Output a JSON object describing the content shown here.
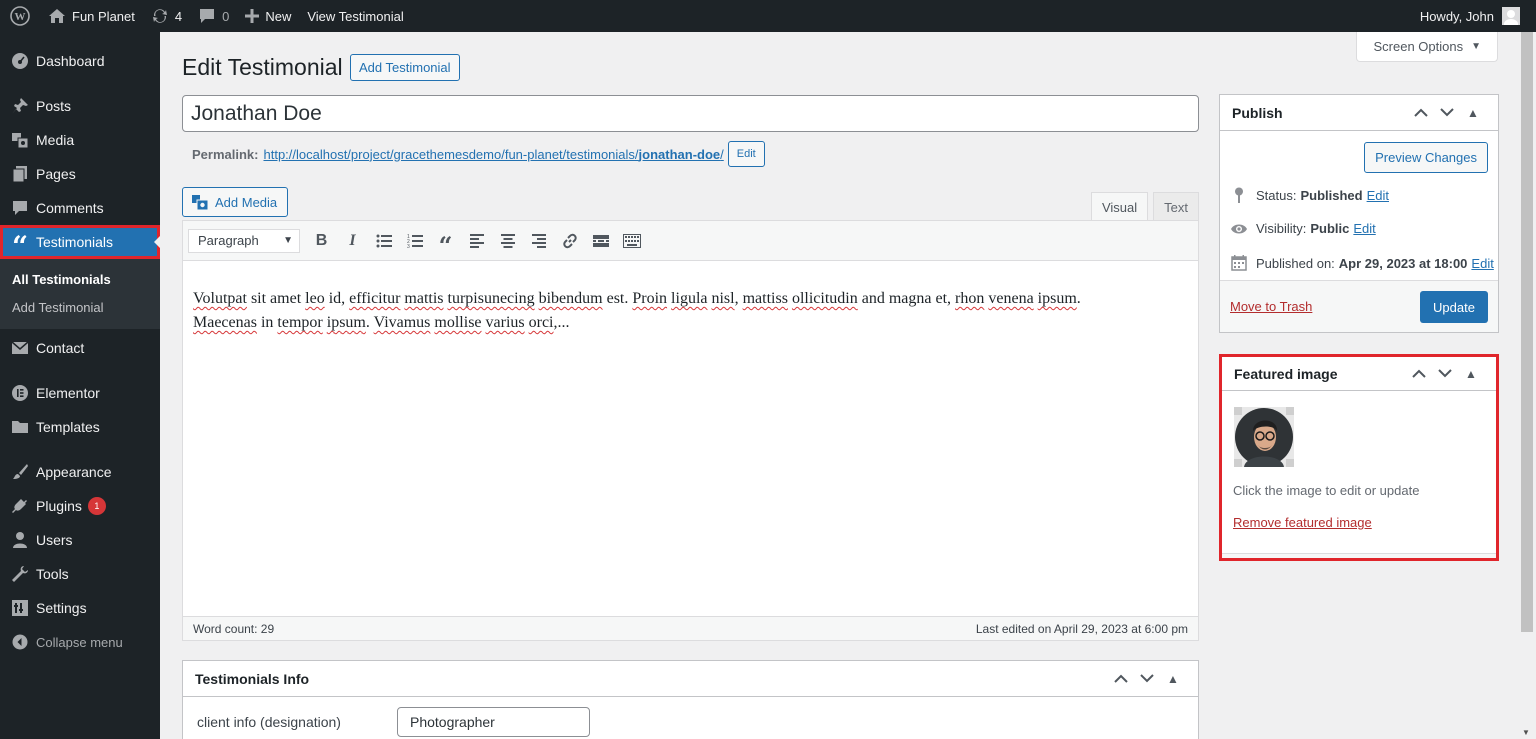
{
  "adminbar": {
    "site_name": "Fun Planet",
    "updates_count": "4",
    "comments_count": "0",
    "new_label": "New",
    "view_label": "View Testimonial",
    "howdy": "Howdy, John"
  },
  "sidebar": {
    "items": [
      {
        "label": "Dashboard",
        "icon": "dashboard-icon"
      },
      {
        "label": "Posts",
        "icon": "pushpin-icon"
      },
      {
        "label": "Media",
        "icon": "media-icon"
      },
      {
        "label": "Pages",
        "icon": "pages-icon"
      },
      {
        "label": "Comments",
        "icon": "comment-icon"
      },
      {
        "label": "Testimonials",
        "icon": "quote-icon"
      },
      {
        "label": "Contact",
        "icon": "envelope-icon"
      },
      {
        "label": "Elementor",
        "icon": "elementor-icon"
      },
      {
        "label": "Templates",
        "icon": "folder-icon"
      },
      {
        "label": "Appearance",
        "icon": "paintbrush-icon"
      },
      {
        "label": "Plugins",
        "icon": "plugin-icon",
        "badge": "1"
      },
      {
        "label": "Users",
        "icon": "user-icon"
      },
      {
        "label": "Tools",
        "icon": "wrench-icon"
      },
      {
        "label": "Settings",
        "icon": "settings-icon"
      }
    ],
    "submenu": [
      "All Testimonials",
      "Add Testimonial"
    ],
    "collapse": "Collapse menu"
  },
  "page": {
    "screen_options": "Screen Options",
    "title": "Edit Testimonial",
    "add_new": "Add Testimonial",
    "post_title": "Jonathan Doe",
    "permalink_label": "Permalink:",
    "permalink_base": "http://localhost/project/gracethemesdemo/fun-planet/testimonials/",
    "permalink_slug": "jonathan-doe",
    "permalink_end": "/",
    "permalink_edit": "Edit"
  },
  "editor": {
    "add_media": "Add Media",
    "tab_visual": "Visual",
    "tab_text": "Text",
    "format": "Paragraph",
    "word_count": "Word count: 29",
    "last_edited": "Last edited on April 29, 2023 at 6:00 pm"
  },
  "info_box": {
    "title": "Testimonials Info",
    "field_label": "client info (designation)",
    "field_value": "Photographer"
  },
  "publish": {
    "title": "Publish",
    "preview": "Preview Changes",
    "status_label": "Status:",
    "status_value": "Published",
    "visibility_label": "Visibility:",
    "visibility_value": "Public",
    "published_label": "Published on:",
    "published_value": "Apr 29, 2023 at 18:00",
    "edit": "Edit",
    "trash": "Move to Trash",
    "update": "Update"
  },
  "featured": {
    "title": "Featured image",
    "help": "Click the image to edit or update",
    "remove": "Remove featured image"
  },
  "colors": {
    "accent": "#2271b1",
    "highlight": "#e0252b",
    "admin_dark": "#1d2327"
  }
}
